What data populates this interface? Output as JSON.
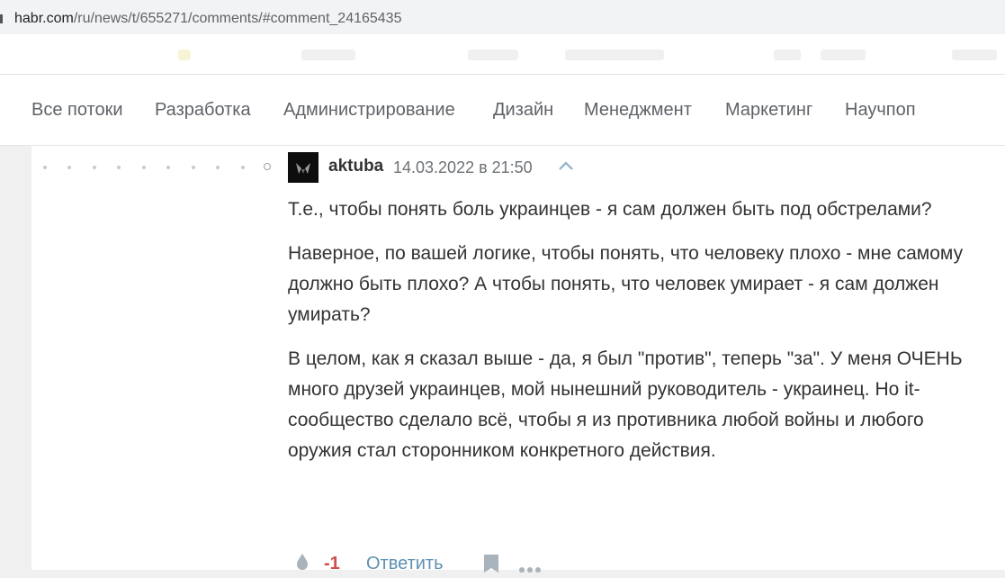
{
  "browser": {
    "url_host": "habr.com",
    "url_path": "/ru/news/t/655271/comments/#comment_24165435"
  },
  "nav": {
    "items": [
      "Все потоки",
      "Разработка",
      "Администрирование",
      "Дизайн",
      "Менеджмент",
      "Маркетинг",
      "Научпоп"
    ]
  },
  "comment": {
    "author": "aktuba",
    "datetime": "14.03.2022 в 21:50",
    "paragraphs": [
      "Т.е., чтобы понять боль украинцев - я сам должен быть под обстрелами?",
      "Наверное, по вашей логике, чтобы понять, что человеку плохо - мне самому должно быть плохо? А чтобы понять, что человек умирает - я сам должен умирать?",
      "В целом, как я сказал выше - да, я был \"против\", теперь \"за\". У меня ОЧЕНЬ много друзей украинцев, мой нынешний руководитель - украинец. Но it-сообщество сделало всё, чтобы я из противника любой войны и любого оружия стал сторонником конкретного действия."
    ],
    "score": "-1",
    "reply_label": "Ответить"
  },
  "icons": {
    "parent": "chevron-up-icon",
    "vote": "drop-icon",
    "bookmark": "bookmark-icon",
    "more": "more-dots-icon"
  },
  "colors": {
    "score_negative": "#d04e4e",
    "link": "#5e8fb2"
  }
}
